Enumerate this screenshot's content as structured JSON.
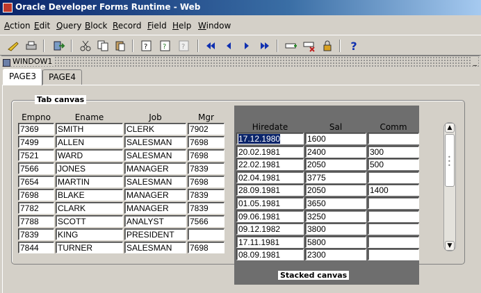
{
  "window": {
    "title": "Oracle Developer Forms Runtime - Web"
  },
  "menu": [
    "Action",
    "Edit",
    "Query",
    "Block",
    "Record",
    "Field",
    "Help",
    "Window"
  ],
  "toolbar": {
    "icons": [
      "save-icon",
      "print-icon",
      "exit-icon",
      "cut-icon",
      "copy-icon",
      "paste-icon",
      "enter-query-icon",
      "execute-query-icon",
      "cancel-query-icon",
      "first-record-icon",
      "previous-record-icon",
      "next-record-icon",
      "last-record-icon",
      "insert-record-icon",
      "delete-record-icon",
      "lock-record-icon",
      "help-icon"
    ]
  },
  "inner_window": {
    "title": "WINDOW1",
    "min_symbol": "_"
  },
  "tabs": [
    {
      "label": "PAGE3",
      "active": true
    },
    {
      "label": "PAGE4",
      "active": false
    }
  ],
  "tab_canvas": {
    "label": "Tab canvas",
    "columns": [
      "Empno",
      "Ename",
      "Job",
      "Mgr"
    ],
    "rows": [
      [
        "7369",
        "SMITH",
        "CLERK",
        "7902"
      ],
      [
        "7499",
        "ALLEN",
        "SALESMAN",
        "7698"
      ],
      [
        "7521",
        "WARD",
        "SALESMAN",
        "7698"
      ],
      [
        "7566",
        "JONES",
        "MANAGER",
        "7839"
      ],
      [
        "7654",
        "MARTIN",
        "SALESMAN",
        "7698"
      ],
      [
        "7698",
        "BLAKE",
        "MANAGER",
        "7839"
      ],
      [
        "7782",
        "CLARK",
        "MANAGER",
        "7839"
      ],
      [
        "7788",
        "SCOTT",
        "ANALYST",
        "7566"
      ],
      [
        "7839",
        "KING",
        "PRESIDENT",
        ""
      ],
      [
        "7844",
        "TURNER",
        "SALESMAN",
        "7698"
      ]
    ]
  },
  "stacked_canvas": {
    "label": "Stacked canvas",
    "columns": [
      "Hiredate",
      "Sal",
      "Comm"
    ],
    "rows": [
      [
        "17.12.1980",
        "1600",
        ""
      ],
      [
        "20.02.1981",
        "2400",
        "300"
      ],
      [
        "22.02.1981",
        "2050",
        "500"
      ],
      [
        "02.04.1981",
        "3775",
        ""
      ],
      [
        "28.09.1981",
        "2050",
        "1400"
      ],
      [
        "01.05.1981",
        "3650",
        ""
      ],
      [
        "09.06.1981",
        "3250",
        ""
      ],
      [
        "09.12.1982",
        "3800",
        ""
      ],
      [
        "17.11.1981",
        "5800",
        ""
      ],
      [
        "08.09.1981",
        "2300",
        ""
      ]
    ],
    "selected_cell": "17.12.1980"
  },
  "colors": {
    "selection": "#0a246a",
    "stacked_bg": "#6e6e6e",
    "titlebar": "#0a246a"
  }
}
